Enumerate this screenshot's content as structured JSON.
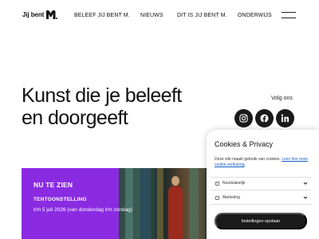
{
  "header": {
    "logo_text": "Jij bent",
    "nav": [
      {
        "label": "BELEEF JIJ BENT M."
      },
      {
        "label": "NIEUWS"
      },
      {
        "label": "DIT IS JIJ BENT M."
      },
      {
        "label": "ONDERWIJS"
      }
    ]
  },
  "hero": {
    "title_line1": "Kunst die je beleeft",
    "title_line2": "en doorgeeft",
    "follow_label": "Volg ons",
    "social": [
      {
        "icon": "instagram-icon"
      },
      {
        "icon": "facebook-icon"
      },
      {
        "icon": "linkedin-icon"
      }
    ]
  },
  "feature": {
    "kicker": "NU TE ZIEN",
    "subtitle": "TENTOONSTELLING",
    "dates": "t/m 5 juli 2026 (van donderdag t/m zondag)",
    "accent_color": "#8a2be2"
  },
  "cookie": {
    "title": "Cookies & Privacy",
    "desc_text": "Deze site maakt gebruik van cookies. ",
    "desc_link": "Lees hier onze cookie verklaring",
    "desc_end": ".",
    "options": [
      {
        "label": "Noodzakelijk",
        "checked": true
      },
      {
        "label": "Marketing",
        "checked": false
      }
    ],
    "save_label": "Instellingen opslaan"
  }
}
